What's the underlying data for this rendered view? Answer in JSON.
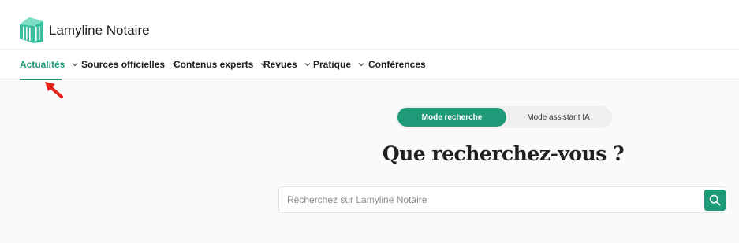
{
  "brand": {
    "name": "Lamyline Notaire",
    "logo_icon": "lamyline-logo-icon",
    "color": "#1f9a78"
  },
  "nav": {
    "items": [
      {
        "label": "Actualités",
        "active": true,
        "has_dropdown": true
      },
      {
        "label": "Sources officielles",
        "active": false,
        "has_dropdown": true
      },
      {
        "label": "Contenus experts",
        "active": false,
        "has_dropdown": true
      },
      {
        "label": "Revues",
        "active": false,
        "has_dropdown": true
      },
      {
        "label": "Pratique",
        "active": false,
        "has_dropdown": true
      },
      {
        "label": "Conférences",
        "active": false,
        "has_dropdown": false
      }
    ]
  },
  "annotation": {
    "icon": "red-arrow-icon",
    "color": "#e0241b"
  },
  "mode_toggle": {
    "options": [
      "Mode recherche",
      "Mode assistant IA"
    ],
    "selected": "Mode recherche"
  },
  "headline": "Que recherchez-vous ?",
  "search": {
    "placeholder": "Recherchez sur Lamyline Notaire",
    "value": "",
    "button_icon": "search-icon"
  }
}
